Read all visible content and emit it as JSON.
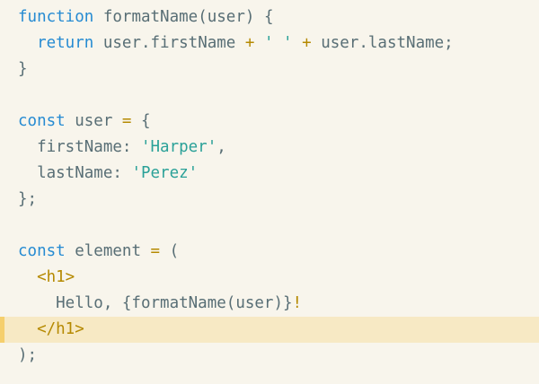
{
  "code": {
    "highlighted_line": 12,
    "lines": [
      [
        {
          "t": "function",
          "c": "kw"
        },
        {
          "t": " formatName(user) {",
          "c": "plain"
        }
      ],
      [
        {
          "t": "  ",
          "c": "plain"
        },
        {
          "t": "return",
          "c": "kw"
        },
        {
          "t": " user.firstName ",
          "c": "plain"
        },
        {
          "t": "+",
          "c": "op"
        },
        {
          "t": " ",
          "c": "plain"
        },
        {
          "t": "' '",
          "c": "str"
        },
        {
          "t": " ",
          "c": "plain"
        },
        {
          "t": "+",
          "c": "op"
        },
        {
          "t": " user.lastName;",
          "c": "plain"
        }
      ],
      [
        {
          "t": "}",
          "c": "plain"
        }
      ],
      [],
      [
        {
          "t": "const",
          "c": "kw"
        },
        {
          "t": " user ",
          "c": "plain"
        },
        {
          "t": "=",
          "c": "op"
        },
        {
          "t": " {",
          "c": "plain"
        }
      ],
      [
        {
          "t": "  firstName: ",
          "c": "plain"
        },
        {
          "t": "'Harper'",
          "c": "str"
        },
        {
          "t": ",",
          "c": "plain"
        }
      ],
      [
        {
          "t": "  lastName: ",
          "c": "plain"
        },
        {
          "t": "'Perez'",
          "c": "str"
        }
      ],
      [
        {
          "t": "};",
          "c": "plain"
        }
      ],
      [],
      [
        {
          "t": "const",
          "c": "kw"
        },
        {
          "t": " element ",
          "c": "plain"
        },
        {
          "t": "=",
          "c": "op"
        },
        {
          "t": " (",
          "c": "plain"
        }
      ],
      [
        {
          "t": "  ",
          "c": "plain"
        },
        {
          "t": "<h1>",
          "c": "tag"
        }
      ],
      [
        {
          "t": "    Hello, {formatName(user)}",
          "c": "plain"
        },
        {
          "t": "!",
          "c": "op"
        }
      ],
      [
        {
          "t": "  ",
          "c": "plain"
        },
        {
          "t": "</h1>",
          "c": "tag"
        }
      ],
      [
        {
          "t": ");",
          "c": "plain"
        }
      ]
    ]
  },
  "colors": {
    "background": "#f8f5ec",
    "keyword": "#268bd2",
    "string": "#2aa198",
    "operator": "#b58900",
    "text": "#586e75",
    "highlight": "#f7e9c4",
    "highlight_bar": "#f5cf6d"
  }
}
